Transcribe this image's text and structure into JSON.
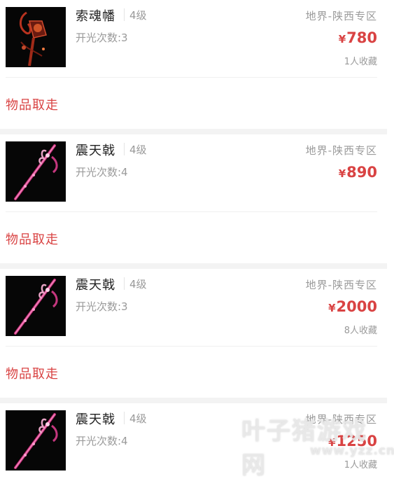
{
  "listings": [
    {
      "name": "索魂幡",
      "level": "4级",
      "kaiguang": "开光次数:3",
      "region": "地界-陕西专区",
      "currency": "¥",
      "price": "780",
      "collect": "1人收藏",
      "action": "物品取走",
      "item_icon": "soul-banner-icon"
    },
    {
      "name": "震天戟",
      "level": "4级",
      "kaiguang": "开光次数:4",
      "region": "地界-陕西专区",
      "currency": "¥",
      "price": "890",
      "collect": "",
      "action": "物品取走",
      "item_icon": "halberd-icon"
    },
    {
      "name": "震天戟",
      "level": "4级",
      "kaiguang": "开光次数:3",
      "region": "地界-陕西专区",
      "currency": "¥",
      "price": "2000",
      "collect": "8人收藏",
      "action": "物品取走",
      "item_icon": "halberd-icon"
    },
    {
      "name": "震天戟",
      "level": "4级",
      "kaiguang": "开光次数:4",
      "region": "地界-陕西专区",
      "currency": "¥",
      "price": "1250",
      "collect": "1人收藏",
      "item_icon": "halberd-icon"
    }
  ],
  "watermark": {
    "main": "叶子猪游戏网",
    "sub": "www.yzz.cn"
  },
  "colors": {
    "price": "#d94343",
    "action": "#d94343",
    "muted": "#9a9a9a",
    "gap": "#f3f3f3"
  }
}
